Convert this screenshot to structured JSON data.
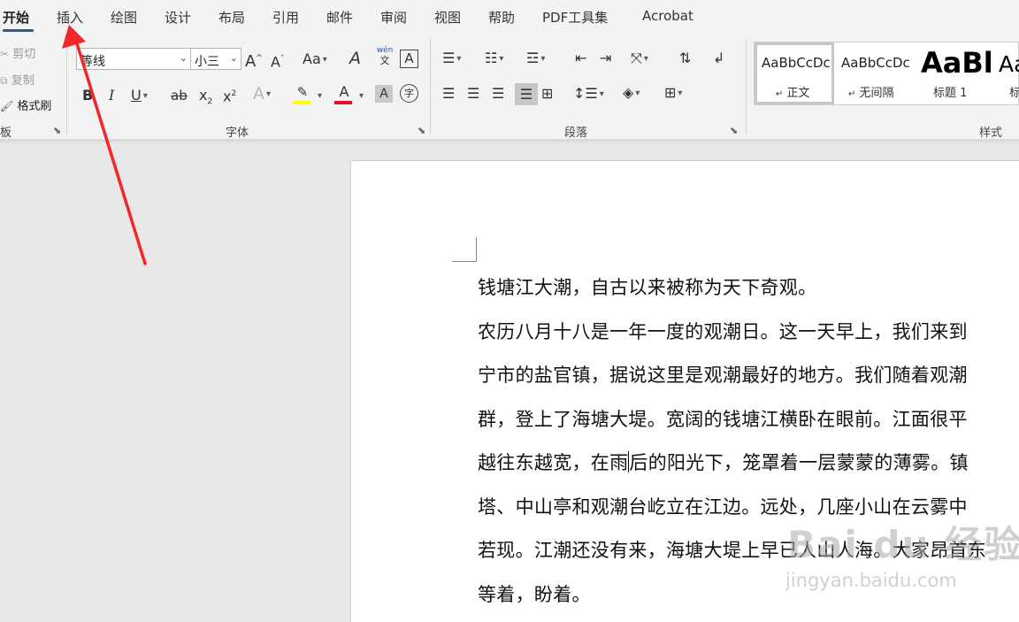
{
  "tabs": [
    "开始",
    "插入",
    "绘图",
    "设计",
    "布局",
    "引用",
    "邮件",
    "审阅",
    "视图",
    "帮助",
    "PDF工具集",
    "Acrobat"
  ],
  "active_tab": "开始",
  "clipboard": {
    "cut": "剪切",
    "copy": "复制",
    "format_painter": "格式刷",
    "label": "板"
  },
  "font": {
    "name": "等线",
    "size": "小三",
    "label": "字体",
    "phonetic_top": "wén",
    "phonetic_bottom": "文",
    "buttons": {
      "grow": "A",
      "shrink": "A",
      "case": "Aa",
      "bold": "B",
      "italic": "I",
      "underline": "U",
      "strike": "ab",
      "subscript": "x",
      "superscript": "x",
      "effects": "A",
      "font_color": "A",
      "shading": "A",
      "enclose": "字"
    }
  },
  "paragraph": {
    "label": "段落"
  },
  "styles": {
    "label": "样式",
    "items": [
      {
        "preview": "AaBbCcDc",
        "name": "正文",
        "mark": "↵"
      },
      {
        "preview": "AaBbCcDc",
        "name": "无间隔",
        "mark": "↵"
      },
      {
        "preview": "AaBl",
        "name": "标题 1",
        "mark": ""
      },
      {
        "preview": "Aa",
        "name": "标",
        "mark": ""
      }
    ]
  },
  "document": {
    "lines": [
      "钱塘江大潮，自古以来被称为天下奇观。",
      "农历八月十八是一年一度的观潮日。这一天早上，我们来到",
      "宁市的盐官镇，据说这里是观潮最好的地方。我们随着观潮",
      "群，登上了海塘大堤。宽阔的钱塘江横卧在眼前。江面很平",
      "越往东越宽，在雨后的阳光下，笼罩着一层蒙蒙的薄雾。镇",
      "塔、中山亭和观潮台屹立在江边。远处，几座小山在云雾中",
      "若现。江潮还没有来，海塘大堤上早已人山人海。大家昂首东",
      "等着，盼着。"
    ],
    "cursor_line_before": "越往东越宽，在雨",
    "cursor_line_after": "后的阳光下，笼罩着一层蒙蒙的薄雾。镇"
  },
  "watermark": {
    "main": "Bai du 经验",
    "sub": "jingyan.baidu.com"
  },
  "colors": {
    "accent": "#2b5797",
    "highlight": "#ffff00",
    "font_color": "#e81123",
    "arrow": "#f22727"
  }
}
